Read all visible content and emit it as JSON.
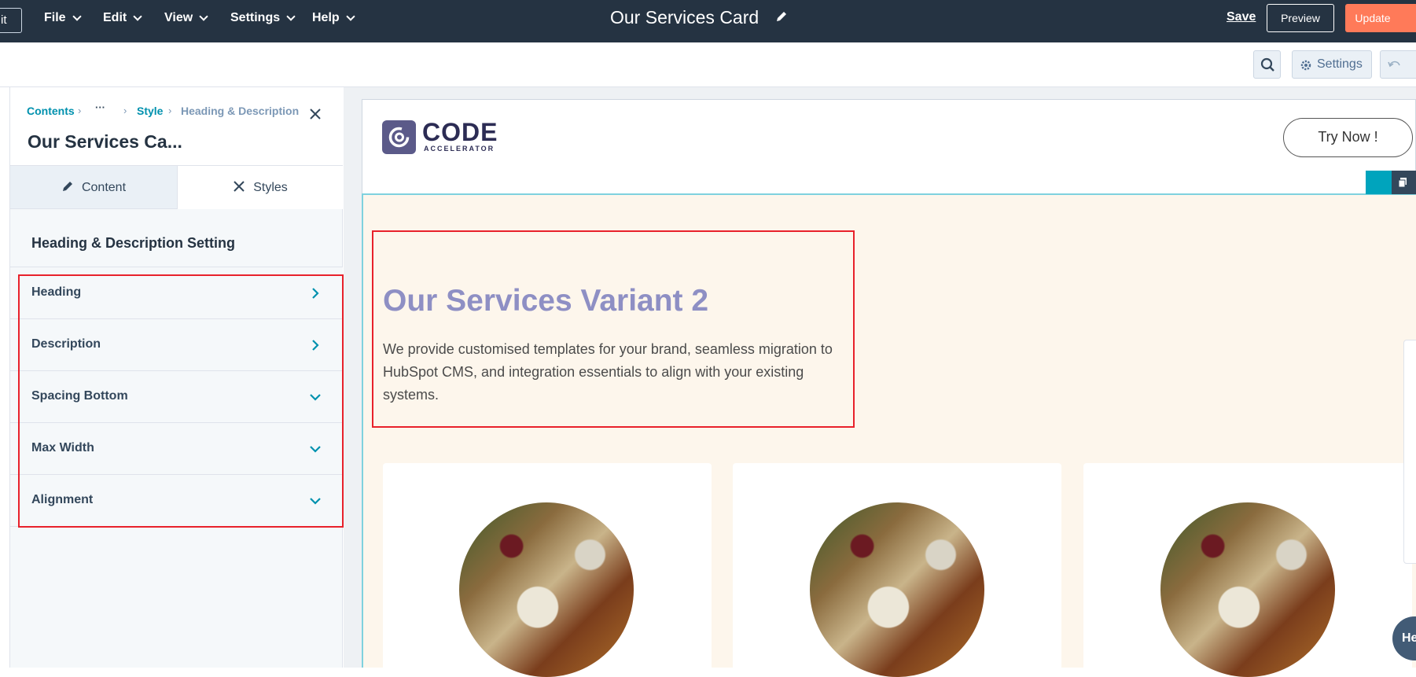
{
  "topbar": {
    "exit_label": "it",
    "menus": [
      "File",
      "Edit",
      "View",
      "Settings",
      "Help"
    ],
    "document_title": "Our Services Card",
    "save_label": "Save",
    "preview_label": "Preview",
    "update_label": "Update"
  },
  "toolbar": {
    "settings_label": "Settings"
  },
  "panel": {
    "breadcrumb": {
      "contents": "Contents",
      "sep1": "›",
      "ellipsis": "···",
      "sep2": "›",
      "style": "Style",
      "sep3": "›",
      "current": "Heading & Description"
    },
    "title": "Our Services Ca...",
    "tabs": {
      "content": "Content",
      "styles": "Styles"
    },
    "section_title": "Heading & Description Setting",
    "items": [
      {
        "label": "Heading",
        "arrow": "right"
      },
      {
        "label": "Description",
        "arrow": "right"
      },
      {
        "label": "Spacing Bottom",
        "arrow": "down"
      },
      {
        "label": "Max Width",
        "arrow": "down"
      },
      {
        "label": "Alignment",
        "arrow": "down"
      }
    ]
  },
  "preview": {
    "logo_main": "CODE",
    "logo_sub": "ACCELERATOR",
    "cta_label": "Try Now !",
    "heading": "Our Services Variant 2",
    "description": "We provide customised templates for your brand, seamless migration to HubSpot CMS, and integration essentials to align with your existing systems.",
    "help_label": "He"
  },
  "colors": {
    "topbar_bg": "#253342",
    "accent_teal": "#00a4bd",
    "update_orange": "#ff7a59",
    "heading_purple": "#8e8fc4",
    "highlight_red": "#e8212b",
    "section_bg": "#fdf6ec"
  }
}
